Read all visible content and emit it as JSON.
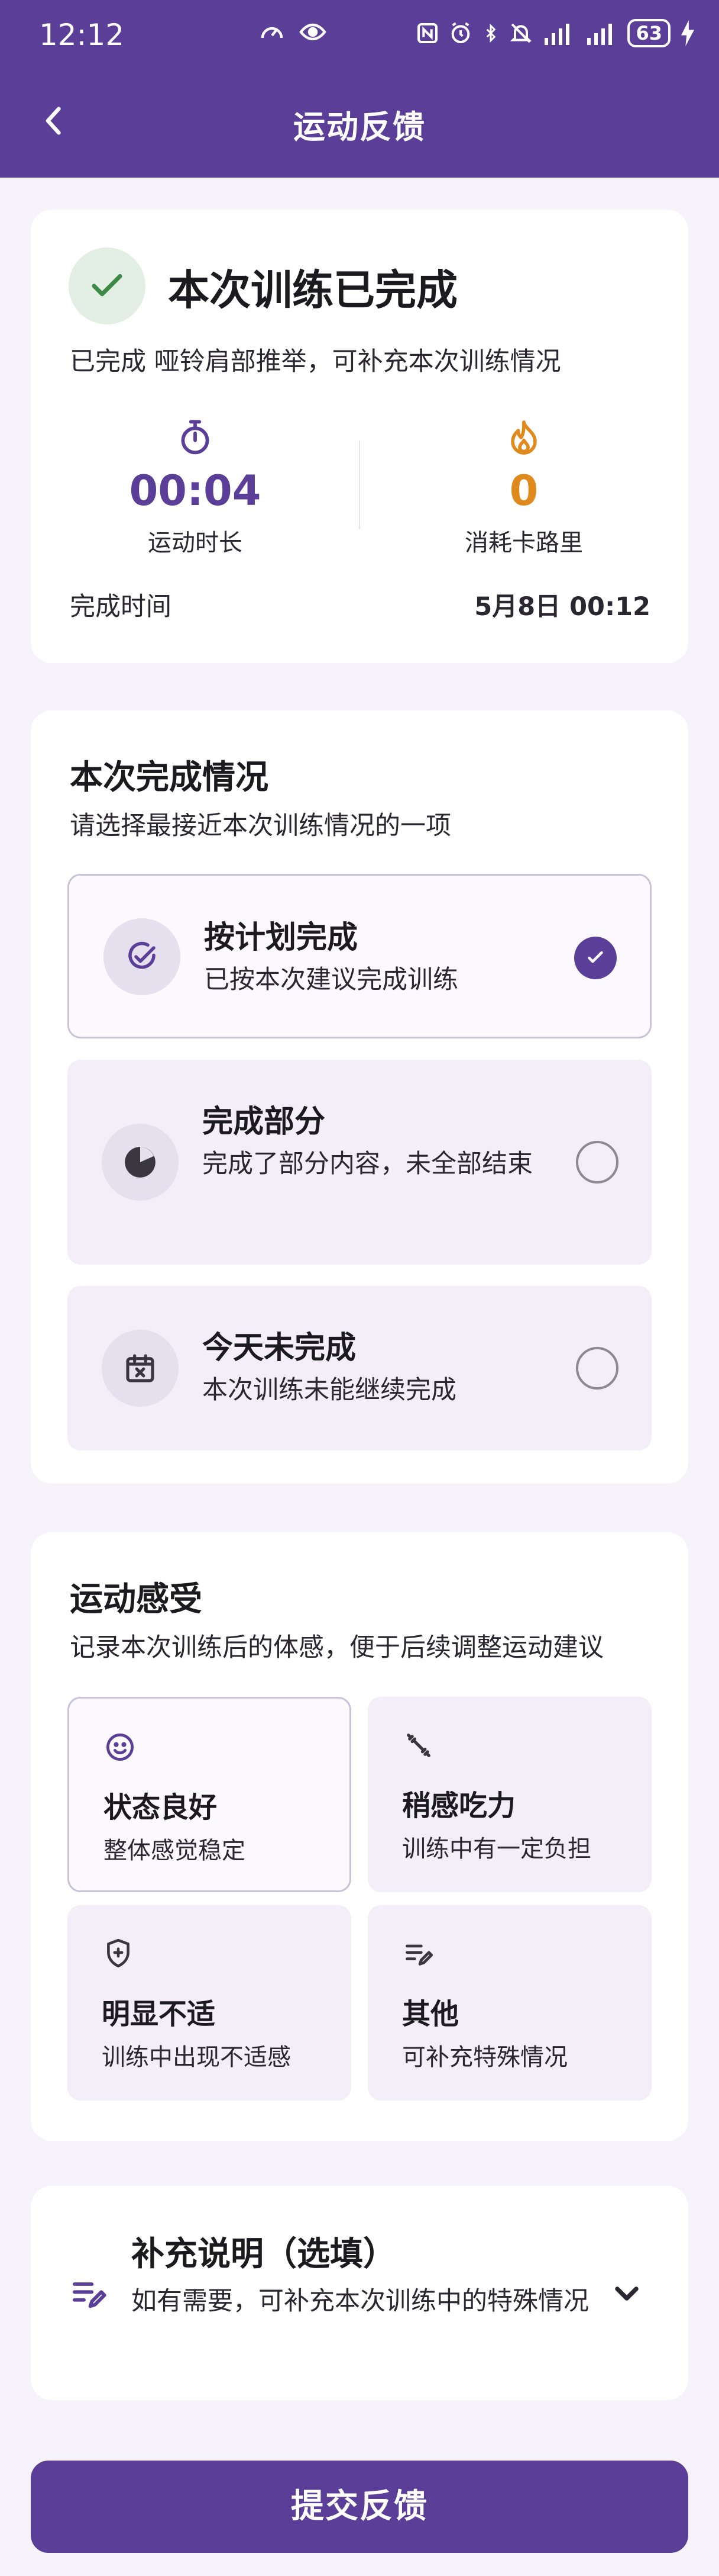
{
  "status_bar": {
    "time": "12:12",
    "battery": "63",
    "icons_left": [
      "speedometer-icon",
      "eye-icon"
    ],
    "icons_right": [
      "nfc-icon",
      "alarm-icon",
      "bluetooth-icon",
      "mute-icon",
      "signal-icon",
      "signal-icon",
      "battery-icon",
      "charging-icon"
    ]
  },
  "nav": {
    "title": "运动反馈",
    "back_icon": "chevron-left-icon"
  },
  "completion": {
    "title": "本次训练已完成",
    "description": "已完成 哑铃肩部推举，可补充本次训练情况",
    "duration_value": "00:04",
    "duration_label": "运动时长",
    "calories_value": "0",
    "calories_label": "消耗卡路里",
    "time_label": "完成时间",
    "time_value": "5月8日 00:12"
  },
  "status_section": {
    "title": "本次完成情况",
    "subtitle": "请选择最接近本次训练情况的一项",
    "options": [
      {
        "title": "按计划完成",
        "desc": "已按本次建议完成训练",
        "selected": true,
        "icon": "check-circle-icon"
      },
      {
        "title": "完成部分",
        "desc": "完成了部分内容，未全部结束",
        "selected": false,
        "icon": "pie-chart-icon"
      },
      {
        "title": "今天未完成",
        "desc": "本次训练未能继续完成",
        "selected": false,
        "icon": "calendar-x-icon"
      }
    ]
  },
  "feel_section": {
    "title": "运动感受",
    "subtitle": "记录本次训练后的体感，便于后续调整运动建议",
    "items": [
      {
        "title": "状态良好",
        "desc": "整体感觉稳定",
        "selected": true,
        "icon": "smile-icon"
      },
      {
        "title": "稍感吃力",
        "desc": "训练中有一定负担",
        "selected": false,
        "icon": "dumbbell-icon"
      },
      {
        "title": "明显不适",
        "desc": "训练中出现不适感",
        "selected": false,
        "icon": "shield-plus-icon"
      },
      {
        "title": "其他",
        "desc": "可补充特殊情况",
        "selected": false,
        "icon": "edit-note-icon"
      }
    ]
  },
  "note_section": {
    "title": "补充说明（选填）",
    "desc": "如有需要，可补充本次训练中的特殊情况",
    "icon": "edit-note-icon",
    "chevron_icon": "chevron-down-icon"
  },
  "submit": {
    "label": "提交反馈"
  },
  "colors": {
    "primary": "#5b3e98",
    "success": "#3c8a45",
    "accent_orange": "#e08a1e",
    "background": "#f6f4fa"
  }
}
